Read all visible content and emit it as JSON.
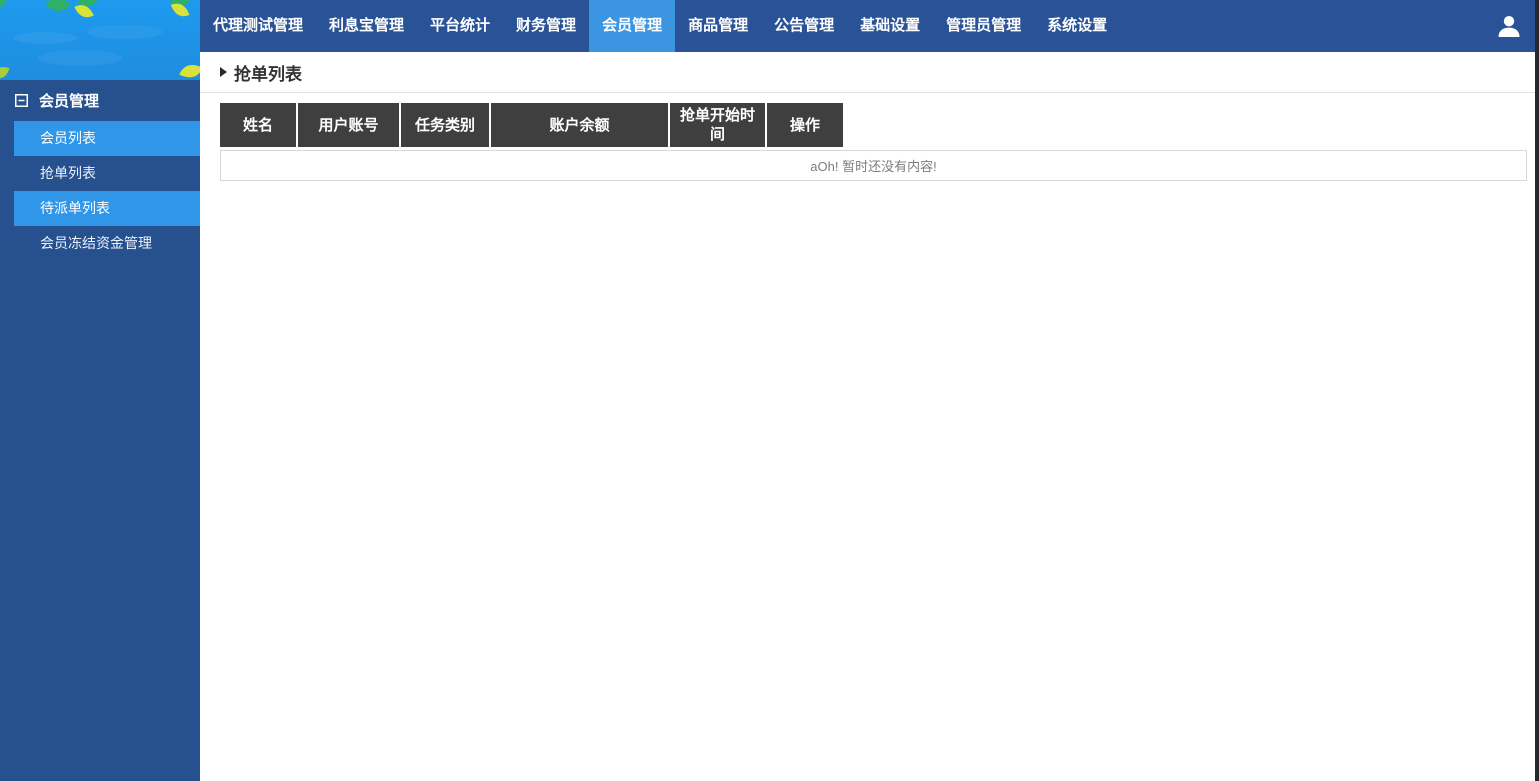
{
  "nav": {
    "items": [
      {
        "label": "代理测试管理",
        "active": false
      },
      {
        "label": "利息宝管理",
        "active": false
      },
      {
        "label": "平台统计",
        "active": false
      },
      {
        "label": "财务管理",
        "active": false
      },
      {
        "label": "会员管理",
        "active": true
      },
      {
        "label": "商品管理",
        "active": false
      },
      {
        "label": "公告管理",
        "active": false
      },
      {
        "label": "基础设置",
        "active": false
      },
      {
        "label": "管理员管理",
        "active": false
      },
      {
        "label": "系统设置",
        "active": false
      }
    ],
    "user_icon": "user-icon"
  },
  "sidebar": {
    "section_label": "会员管理",
    "collapse_icon": "collapse-minus-icon",
    "items": [
      {
        "label": "会员列表",
        "highlighted": true
      },
      {
        "label": "抢单列表",
        "highlighted": false
      },
      {
        "label": "待派单列表",
        "highlighted": true
      },
      {
        "label": "会员冻结资金管理",
        "highlighted": false
      }
    ]
  },
  "breadcrumb": {
    "title": "抢单列表"
  },
  "table": {
    "headers": [
      "姓名",
      "用户账号",
      "任务类别",
      "账户余额",
      "抢单开始时间",
      "操作"
    ],
    "empty_message": "aOh! 暂时还没有内容!"
  },
  "colors": {
    "nav_bg": "#2a5296",
    "nav_active": "#3b95e0",
    "sidebar_bg": "#27508f",
    "sidebar_highlight": "#3096e8",
    "logo_blue": "#1d9aee",
    "leaf_green": "#2eb066",
    "leaf_yellow": "#d7e23a",
    "table_header_bg": "#3f3f3f",
    "border_gray": "#d8d8d8"
  }
}
